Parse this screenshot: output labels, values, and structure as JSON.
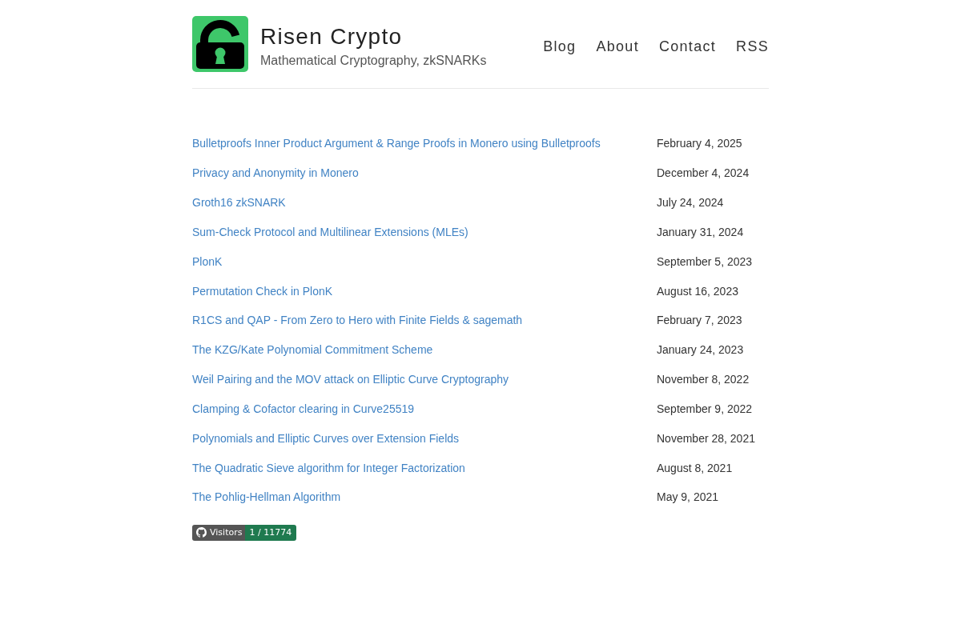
{
  "header": {
    "title": "Risen Crypto",
    "subtitle": "Mathematical Cryptography, zkSNARKs"
  },
  "nav": [
    "Blog",
    "About",
    "Contact",
    "RSS"
  ],
  "posts": [
    {
      "title": "Bulletproofs Inner Product Argument & Range Proofs in Monero using Bulletproofs",
      "date": "February 4, 2025"
    },
    {
      "title": "Privacy and Anonymity in Monero",
      "date": "December 4, 2024"
    },
    {
      "title": "Groth16 zkSNARK",
      "date": "July 24, 2024"
    },
    {
      "title": "Sum-Check Protocol and Multilinear Extensions (MLEs)",
      "date": "January 31, 2024"
    },
    {
      "title": "PlonK",
      "date": "September 5, 2023"
    },
    {
      "title": "Permutation Check in PlonK",
      "date": "August 16, 2023"
    },
    {
      "title": "R1CS and QAP - From Zero to Hero with Finite Fields & sagemath",
      "date": "February 7, 2023"
    },
    {
      "title": "The KZG/Kate Polynomial Commitment Scheme",
      "date": "January 24, 2023"
    },
    {
      "title": "Weil Pairing and the MOV attack on Elliptic Curve Cryptography",
      "date": "November 8, 2022"
    },
    {
      "title": "Clamping & Cofactor clearing in Curve25519",
      "date": "September 9, 2022"
    },
    {
      "title": "Polynomials and Elliptic Curves over Extension Fields",
      "date": "November 28, 2021"
    },
    {
      "title": "The Quadratic Sieve algorithm for Integer Factorization",
      "date": "August 8, 2021"
    },
    {
      "title": "The Pohlig-Hellman Algorithm",
      "date": "May 9, 2021"
    }
  ],
  "visitor_badge": {
    "label": "Visitors",
    "count": "1 / 11774"
  }
}
